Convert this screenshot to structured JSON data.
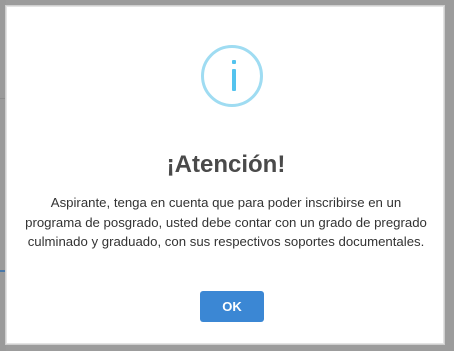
{
  "dialog": {
    "title": "¡Atención!",
    "message": "Aspirante, tenga en cuenta que para poder inscribirse en un programa de posgrado, usted debe contar con un grado de pregrado culminado y graduado, con sus respectivos soportes documentales.",
    "icon": "info-icon",
    "ok_label": "OK"
  },
  "colors": {
    "icon_ring": "#9fdcf2",
    "icon_glyph": "#54c3ee",
    "button": "#3b87d4",
    "title": "#4a4a4a",
    "overlay": "#9c9c9c"
  }
}
